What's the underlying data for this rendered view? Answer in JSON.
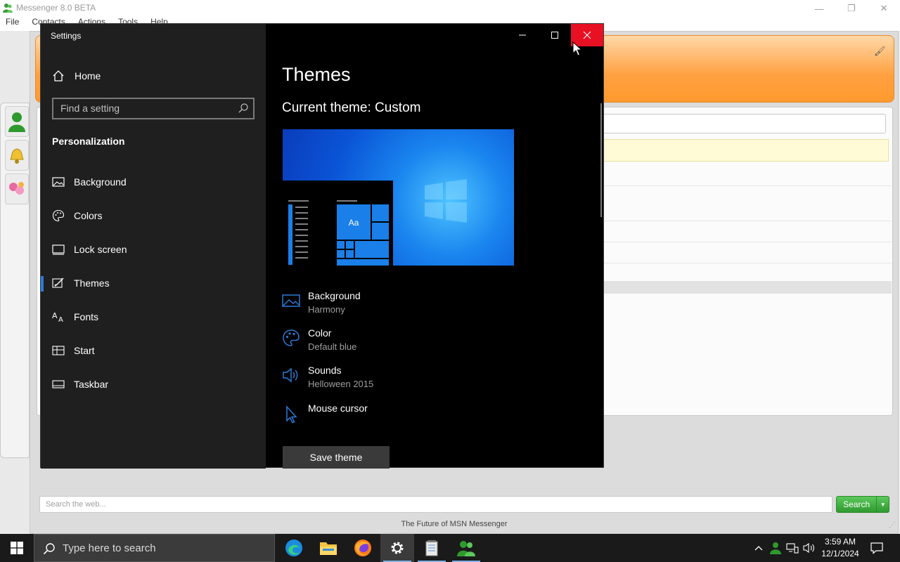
{
  "messenger": {
    "title": "Messenger 8.0 BETA",
    "menu": [
      "File",
      "Contacts",
      "Actions",
      "Tools",
      "Help"
    ],
    "web_search_placeholder": "Search the web...",
    "search_button": "Search",
    "footer": "The Future of MSN Messenger"
  },
  "settings": {
    "window_title": "Settings",
    "home_label": "Home",
    "search_placeholder": "Find a setting",
    "section": "Personalization",
    "nav_items": [
      {
        "label": "Background",
        "icon": "picture-icon"
      },
      {
        "label": "Colors",
        "icon": "palette-icon"
      },
      {
        "label": "Lock screen",
        "icon": "lock-screen-icon"
      },
      {
        "label": "Themes",
        "icon": "themes-icon",
        "selected": true
      },
      {
        "label": "Fonts",
        "icon": "fonts-icon"
      },
      {
        "label": "Start",
        "icon": "start-icon"
      },
      {
        "label": "Taskbar",
        "icon": "taskbar-icon"
      }
    ],
    "heading": "Themes",
    "current_theme": "Current theme: Custom",
    "preview_tile_text": "Aa",
    "theme_items": [
      {
        "name": "Background",
        "value": "Harmony",
        "icon": "picture-icon"
      },
      {
        "name": "Color",
        "value": "Default blue",
        "icon": "palette-icon"
      },
      {
        "name": "Sounds",
        "value": "Helloween 2015",
        "icon": "speaker-icon"
      },
      {
        "name": "Mouse cursor",
        "value": "",
        "icon": "cursor-icon"
      }
    ],
    "save_button": "Save theme",
    "accent_color": "#2b7ad6",
    "close_hover_color": "#e81123"
  },
  "taskbar": {
    "search_placeholder": "Type here to search",
    "time": "3:59 AM",
    "date": "12/1/2024",
    "apps": [
      "edge-icon",
      "file-explorer-icon",
      "firefox-icon",
      "settings-icon",
      "notepad-icon",
      "messenger-icon"
    ]
  }
}
